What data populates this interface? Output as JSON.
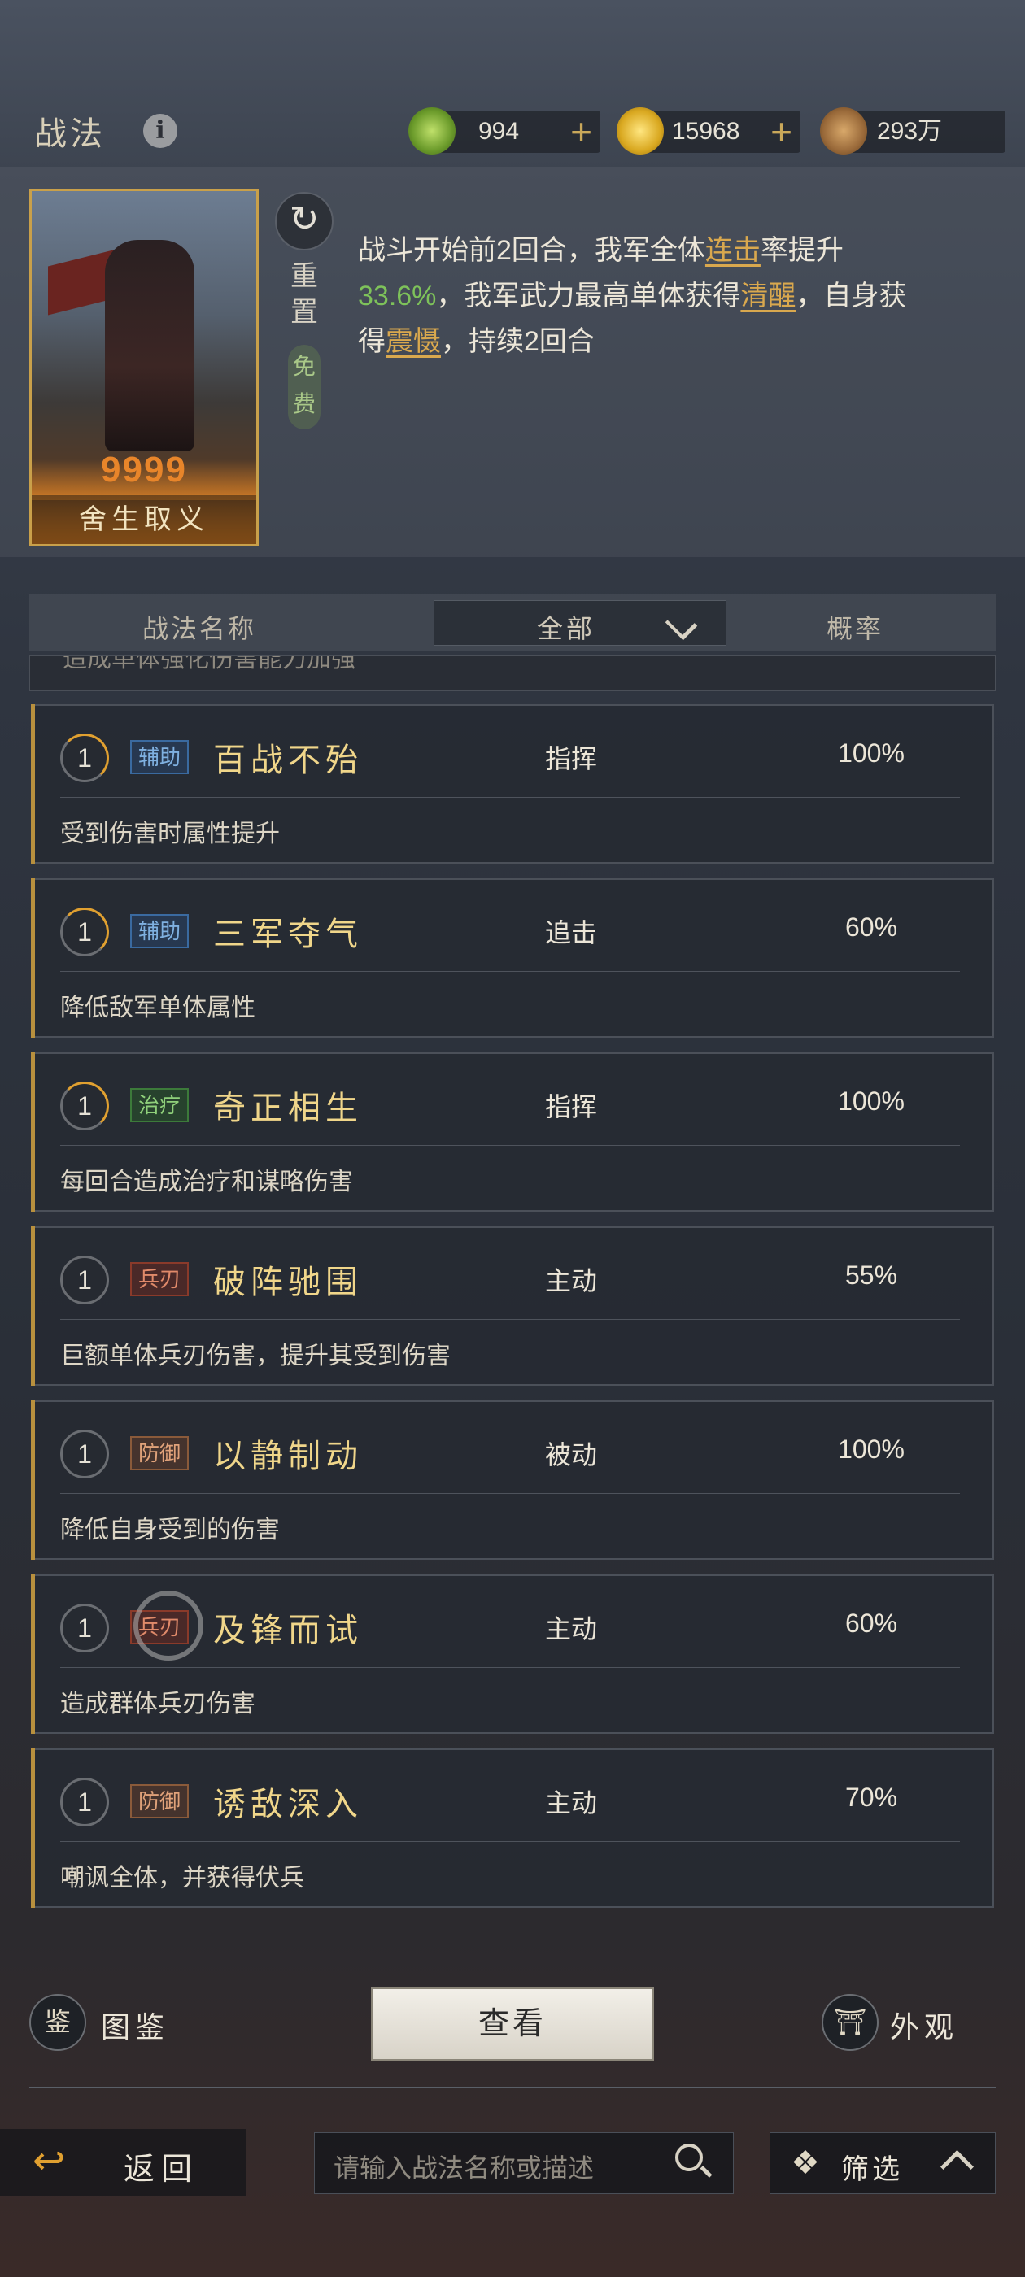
{
  "header": {
    "title": "战法",
    "info_icon": "i",
    "resources": [
      {
        "icon": "jade-coin-icon",
        "value": "994",
        "plus": "+"
      },
      {
        "icon": "gold-coin-icon",
        "value": "15968",
        "plus": "+"
      },
      {
        "icon": "copper-coin-icon",
        "value": "293万"
      }
    ]
  },
  "hero": {
    "card_name": "舍生取义",
    "stars": "9999",
    "reset_icon": "↻",
    "reset_label": "重置",
    "free_label": "免费",
    "description": {
      "p1": "战斗开始前2回合，我军全体",
      "k1": "连击",
      "p2": "率提升",
      "g1": "33.6%",
      "p3": "，我军武力最高单体获得",
      "k2": "清醒",
      "p4": "，自身获得",
      "k3": "震慑",
      "p5": "，持续2回合"
    }
  },
  "list_header": {
    "name_col": "战法名称",
    "filter_value": "全部",
    "rate_col": "概率"
  },
  "partial_row_text": "造成单体强化伤害能力加强",
  "tactics": [
    {
      "level": "1",
      "tag": "辅助",
      "name": "百战不殆",
      "type": "指挥",
      "rate": "100%",
      "desc": "受到伤害时属性提升"
    },
    {
      "level": "1",
      "tag": "辅助",
      "name": "三军夺气",
      "type": "追击",
      "rate": "60%",
      "desc": "降低敌军单体属性"
    },
    {
      "level": "1",
      "tag": "治疗",
      "name": "奇正相生",
      "type": "指挥",
      "rate": "100%",
      "desc": "每回合造成治疗和谋略伤害"
    },
    {
      "level": "1",
      "tag": "兵刃",
      "name": "破阵驰围",
      "type": "主动",
      "rate": "55%",
      "desc": "巨额单体兵刃伤害，提升其受到伤害"
    },
    {
      "level": "1",
      "tag": "防御",
      "name": "以静制动",
      "type": "被动",
      "rate": "100%",
      "desc": "降低自身受到的伤害"
    },
    {
      "level": "1",
      "tag": "兵刃",
      "name": "及锋而试",
      "type": "主动",
      "rate": "60%",
      "desc": "造成群体兵刃伤害"
    },
    {
      "level": "1",
      "tag": "防御",
      "name": "诱敌深入",
      "type": "主动",
      "rate": "70%",
      "desc": "嘲讽全体，并获得伏兵"
    }
  ],
  "bottom": {
    "codex_icon": "鉴",
    "codex_label": "图鉴",
    "view_label": "查看",
    "appearance_icon": "⛩",
    "appearance_label": "外观",
    "back_icon": "↩",
    "back_label": "返回",
    "search_placeholder": "请输入战法名称或描述",
    "filter_icon": "❖",
    "filter_label": "筛选"
  }
}
